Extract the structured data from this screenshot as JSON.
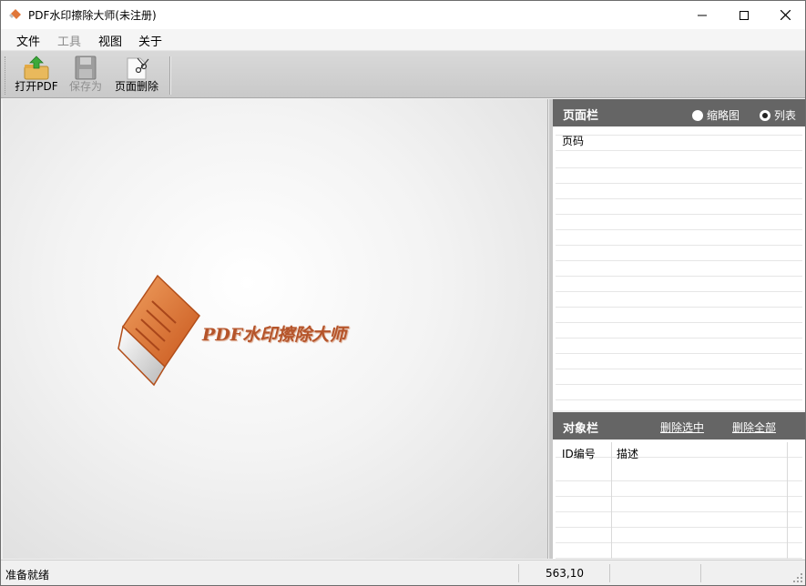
{
  "window": {
    "title": "PDF水印擦除大师(未注册)"
  },
  "menu": {
    "items": [
      {
        "label": "文件",
        "enabled": true
      },
      {
        "label": "工具",
        "enabled": false
      },
      {
        "label": "视图",
        "enabled": true
      },
      {
        "label": "关于",
        "enabled": true
      }
    ]
  },
  "toolbar": {
    "buttons": [
      {
        "label": "打开PDF",
        "icon": "open-folder-icon",
        "enabled": true
      },
      {
        "label": "保存为",
        "icon": "floppy-disk-icon",
        "enabled": false
      },
      {
        "label": "页面删除",
        "icon": "scissors-page-icon",
        "enabled": true
      }
    ]
  },
  "canvas": {
    "logo_text": "PDF水印擦除大师"
  },
  "page_panel": {
    "title": "页面栏",
    "view_options": [
      {
        "label": "缩略图",
        "selected": false
      },
      {
        "label": "列表",
        "selected": true
      }
    ],
    "columns": [
      "页码"
    ]
  },
  "object_panel": {
    "title": "对象栏",
    "links": [
      "删除选中",
      "删除全部"
    ],
    "columns": [
      "ID编号",
      "描述"
    ]
  },
  "status": {
    "text": "准备就绪",
    "coords": "563,10"
  },
  "colors": {
    "panel_header": "#656565",
    "logo_orange": "#d2692e"
  }
}
